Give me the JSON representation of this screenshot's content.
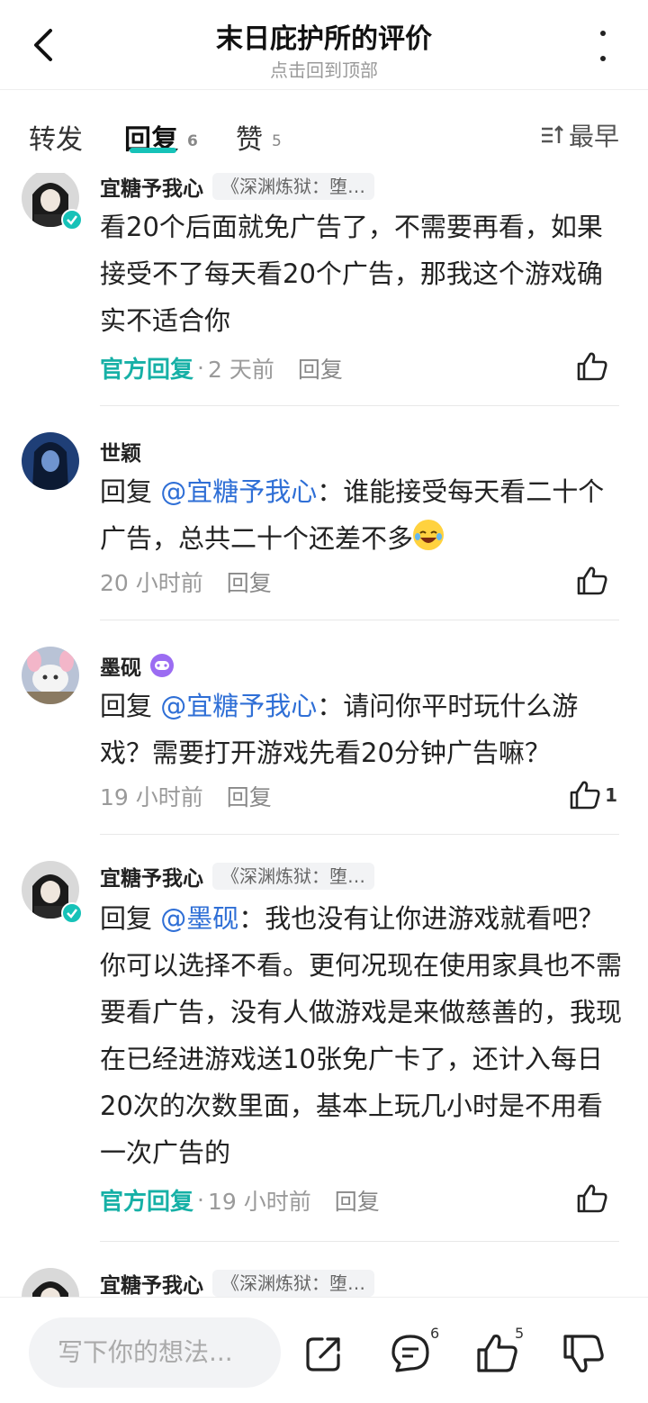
{
  "header": {
    "title": "末日庇护所的评价",
    "subtitle": "点击回到顶部"
  },
  "tabs": [
    {
      "label": "转发",
      "count": ""
    },
    {
      "label": "回复",
      "count": "6"
    },
    {
      "label": "赞",
      "count": "5"
    }
  ],
  "sort_label": "最早",
  "comments": [
    {
      "name": "宜糖予我心",
      "tag": "《深渊炼狱：堕…",
      "text": "看20个后面就免广告了，不需要再看，如果接受不了每天看20个广告，那我这个游戏确实不适合你",
      "official": "官方回复",
      "time": "2 天前",
      "reply": "回复",
      "likes": ""
    },
    {
      "name": "世颖",
      "prefix": "回复",
      "mention": "@宜糖予我心",
      "text": "：谁能接受每天看二十个广告，总共二十个还差不多",
      "time": "20 小时前",
      "reply": "回复",
      "likes": ""
    },
    {
      "name": "墨砚",
      "prefix": "回复",
      "mention": "@宜糖予我心",
      "text": "：请问你平时玩什么游戏？需要打开游戏先看20分钟广告嘛？",
      "time": "19 小时前",
      "reply": "回复",
      "likes": "1"
    },
    {
      "name": "宜糖予我心",
      "tag": "《深渊炼狱：堕…",
      "prefix": "回复",
      "mention": "@墨砚",
      "text": "：我也没有让你进游戏就看吧？你可以选择不看。更何况现在使用家具也不需要看广告，没有人做游戏是来做慈善的，我现在已经进游戏送10张免广卡了，还计入每日20次的次数里面，基本上玩几小时是不用看一次广告的",
      "official": "官方回复",
      "time": "19 小时前",
      "reply": "回复",
      "likes": ""
    },
    {
      "name": "宜糖予我心",
      "tag": "《深渊炼狱：堕…"
    }
  ],
  "bottom": {
    "placeholder": "写下你的想法...",
    "comment_count": "6",
    "like_count": "5"
  },
  "accent_color": "#16c2b8",
  "mention_color": "#2f6fd6"
}
